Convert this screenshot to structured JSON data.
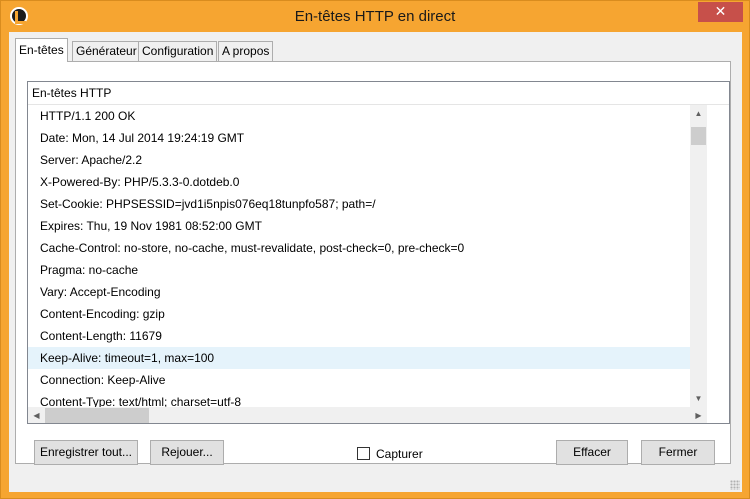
{
  "window": {
    "title": "En-têtes HTTP en direct",
    "close_glyph": "✕",
    "accent_color": "#f6a531"
  },
  "tabs": [
    {
      "label": "En-têtes",
      "active": true
    },
    {
      "label": "Générateur",
      "active": false
    },
    {
      "label": "Configuration",
      "active": false
    },
    {
      "label": "A propos",
      "active": false
    }
  ],
  "list": {
    "header": "En-têtes HTTP",
    "rows": [
      "HTTP/1.1 200 OK",
      "Date: Mon, 14 Jul 2014 19:24:19 GMT",
      "Server: Apache/2.2",
      "X-Powered-By: PHP/5.3.3-0.dotdeb.0",
      "Set-Cookie: PHPSESSID=jvd1i5npis076eq18tunpfo587; path=/",
      "Expires: Thu, 19 Nov 1981 08:52:00 GMT",
      "Cache-Control: no-store, no-cache, must-revalidate, post-check=0, pre-check=0",
      "Pragma: no-cache",
      "Vary: Accept-Encoding",
      "Content-Encoding: gzip",
      "Content-Length: 11679",
      "Keep-Alive: timeout=1, max=100",
      "Connection: Keep-Alive",
      "Content-Type: text/html; charset=utf-8"
    ],
    "selected_index": 11
  },
  "buttons": {
    "save_all": "Enregistrer tout...",
    "replay": "Rejouer...",
    "clear": "Effacer",
    "close": "Fermer"
  },
  "capture": {
    "label": "Capturer",
    "checked": false
  },
  "icons": {
    "app": "app-logo-icon",
    "close": "close-icon",
    "scroll_up": "chevron-up-icon",
    "scroll_down": "chevron-down-icon",
    "scroll_left": "chevron-left-icon",
    "scroll_right": "chevron-right-icon"
  }
}
